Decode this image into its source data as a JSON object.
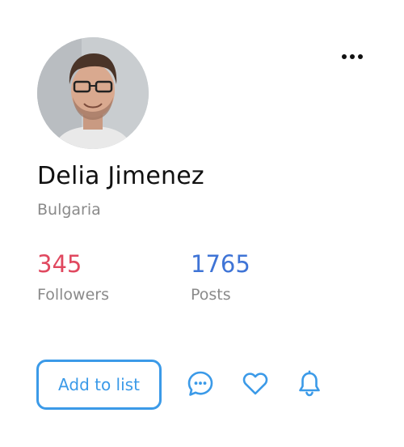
{
  "profile": {
    "name": "Delia Jimenez",
    "location": "Bulgaria"
  },
  "stats": {
    "followers": {
      "value": "345",
      "label": "Followers",
      "color": "#e0485f"
    },
    "posts": {
      "value": "1765",
      "label": "Posts",
      "color": "#3f74d6"
    }
  },
  "actions": {
    "add_to_list_label": "Add to list",
    "accent_color": "#3b9ae8"
  },
  "icons": {
    "menu": "more-horizontal-icon",
    "chat": "chat-bubble-icon",
    "like": "heart-icon",
    "notify": "bell-icon"
  }
}
